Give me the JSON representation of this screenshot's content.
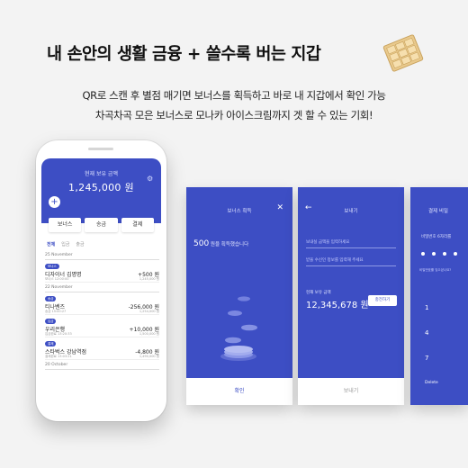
{
  "headline": "내 손안의 생활 금융 + 쓸수록 버는 지갑",
  "subtitle": {
    "line1": "QR로 스캔 후 별점 매기면 보너스를 획득하고 바로 내 지갑에서 확인 가능",
    "line2": "차곡차곡 모은 보너스로 모나카 아이스크림까지 겟 할 수 있는 기회!"
  },
  "colors": {
    "accent": "#3d4ec4",
    "background": "#f3f3f3"
  },
  "phone": {
    "balance_label": "현재 보유 금액",
    "balance_amount": "1,245,000 원",
    "plus_icon": "+",
    "gear_icon": "⚙",
    "buttons": [
      "보너스",
      "송금",
      "결제"
    ],
    "tabs": [
      "전체",
      "입금",
      "출금"
    ],
    "groups": [
      {
        "date": "25 November",
        "items": [
          {
            "badge": "보너스",
            "name": "디자이너 김명명",
            "sub": "보너스 12:00:00",
            "amount": "+500 원",
            "balance": "1,245,000 원"
          }
        ]
      },
      {
        "date": "22 November",
        "items": [
          {
            "badge": "송금",
            "name": "티나벤즈",
            "sub": "송금 15:00:27",
            "amount": "-256,000 원",
            "balance": "1,254,000 원"
          },
          {
            "badge": "입금",
            "name": "우리은행",
            "sub": "입금완료 13:20:33",
            "amount": "+10,000 원",
            "balance": "1,500,000 원"
          },
          {
            "badge": "결제",
            "name": "스타벅스 강남역점",
            "sub": "결제완료 13:03:21",
            "amount": "-4,800 원",
            "balance": "1,490,000 원"
          }
        ]
      },
      {
        "date": "20 October",
        "items": []
      }
    ]
  },
  "screen_bonus": {
    "title": "보너스 획득",
    "close_icon": "✕",
    "amount": "500",
    "text": " 원을 획득했습니다",
    "footer": "확인"
  },
  "screen_send": {
    "title": "보내기",
    "back_icon": "←",
    "field1_placeholder": "보내실 금액을 입력하세요",
    "field2_placeholder": "받을 수신인 정보를 입력해 주세요",
    "balance_label": "현재 보유 금액",
    "balance_amount": "12,345,678 원",
    "charge_button": "충전하기",
    "footer": "보내기"
  },
  "screen_pin": {
    "title": "결제 비밀",
    "label": "비밀번호 6자리를",
    "hint": "비밀번호를 잊으셨나요?",
    "keys": [
      "1",
      "4",
      "7",
      "Delete"
    ]
  }
}
